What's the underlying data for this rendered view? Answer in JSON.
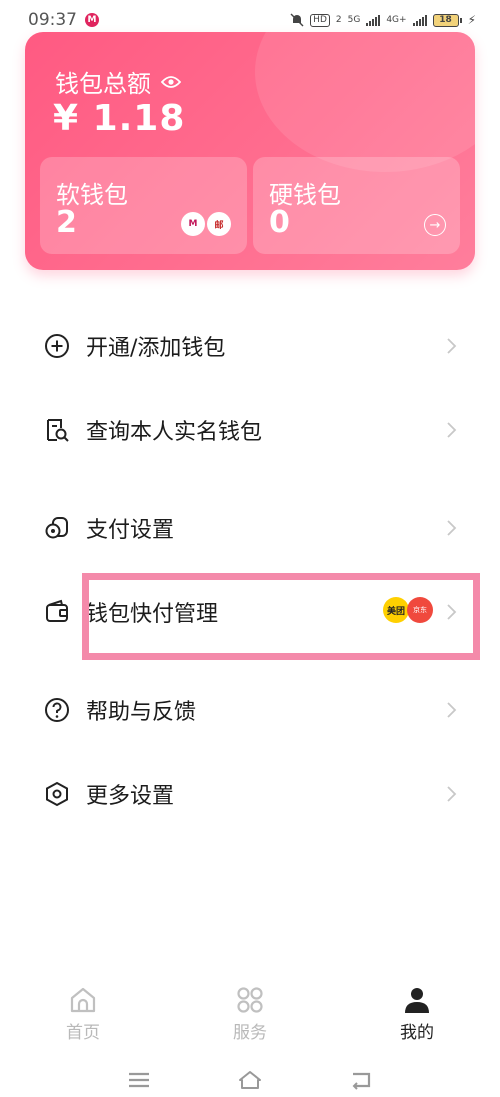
{
  "status_bar": {
    "time": "09:37",
    "app_badge": "M",
    "sim_chip": "HD",
    "sim_slot": "2",
    "net_a": "5G",
    "net_b": "4G+",
    "battery": "18"
  },
  "card": {
    "title": "钱包总额",
    "total": "¥ 1.18",
    "soft": {
      "title": "软钱包",
      "count": "2",
      "bank1": "M",
      "bank2": "邮"
    },
    "hard": {
      "title": "硬钱包",
      "count": "0"
    }
  },
  "menu": [
    {
      "label": "开通/添加钱包",
      "icon": "plus-circle-icon"
    },
    {
      "label": "查询本人实名钱包",
      "icon": "search-document-icon"
    },
    {
      "label": "支付设置",
      "icon": "payment-settings-icon"
    },
    {
      "label": "钱包快付管理",
      "icon": "wallet-icon",
      "badges": [
        "美团",
        "京东"
      ]
    },
    {
      "label": "帮助与反馈",
      "icon": "help-icon"
    },
    {
      "label": "更多设置",
      "icon": "hex-settings-icon"
    }
  ],
  "bottom_nav": [
    {
      "label": "首页",
      "icon": "home-icon"
    },
    {
      "label": "服务",
      "icon": "grid-icon"
    },
    {
      "label": "我的",
      "icon": "user-icon",
      "active": true
    }
  ],
  "colors": {
    "card_pink": "#ff6d8f",
    "highlight": "#f48aaa",
    "nav_inactive": "#b9b9b9"
  }
}
